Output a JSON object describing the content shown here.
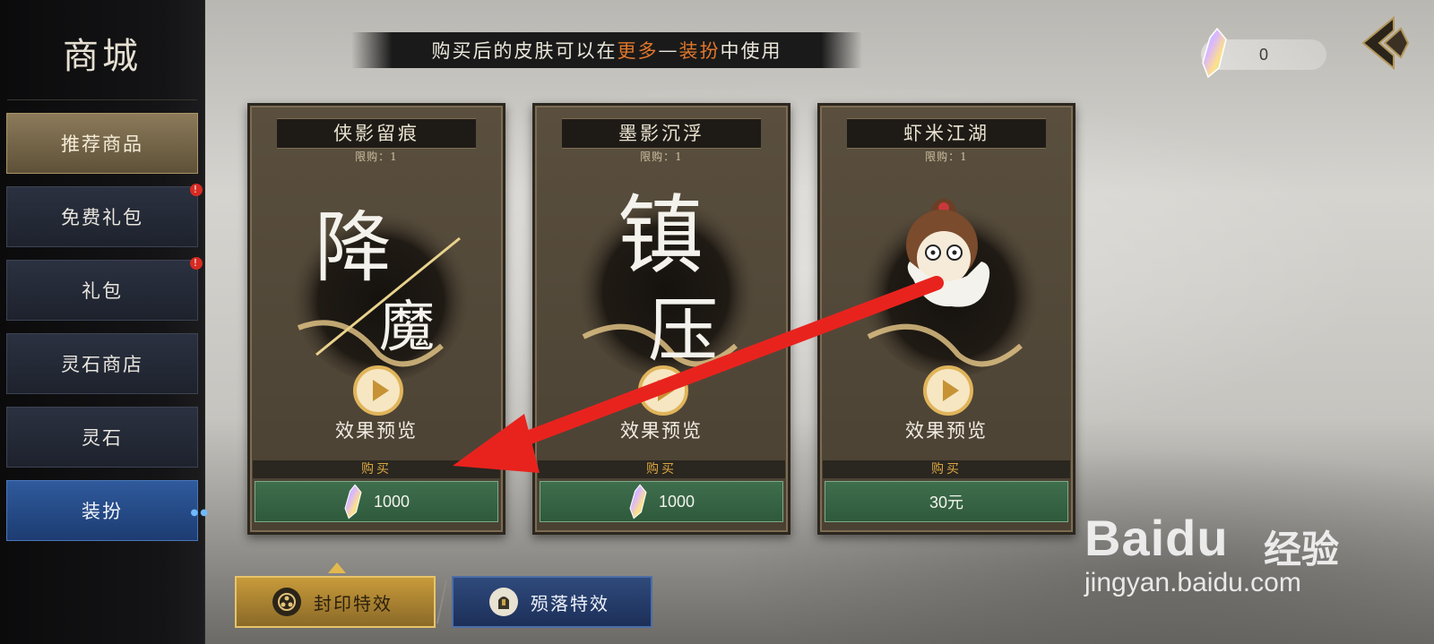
{
  "sidebar": {
    "title": "商城",
    "items": [
      {
        "label": "推荐商品"
      },
      {
        "label": "免费礼包",
        "badge": "!"
      },
      {
        "label": "礼包",
        "badge": "!"
      },
      {
        "label": "灵石商店"
      },
      {
        "label": "灵石"
      },
      {
        "label": "装扮"
      }
    ]
  },
  "banner": {
    "prefix": "购买后的皮肤可以在",
    "hl1": "更多",
    "dash": "—",
    "hl2": "装扮",
    "suffix": "中使用"
  },
  "currency": {
    "value": "0",
    "icon": "spirit-crystal-icon"
  },
  "cards": [
    {
      "title": "侠影留痕",
      "limit": "限购：1",
      "art_text": [
        "降",
        "魔"
      ],
      "preview": "效果预览",
      "buy": "购买",
      "price": "1000",
      "price_icon": "spirit-crystal-icon"
    },
    {
      "title": "墨影沉浮",
      "limit": "限购：1",
      "art_text": [
        "镇",
        "压"
      ],
      "preview": "效果预览",
      "buy": "购买",
      "price": "1000",
      "price_icon": "spirit-crystal-icon"
    },
    {
      "title": "虾米江湖",
      "limit": "限购：1",
      "preview": "效果预览",
      "buy": "购买",
      "price": "30元"
    }
  ],
  "bottom_tabs": [
    {
      "label": "封印特效",
      "icon": "seal-icon"
    },
    {
      "label": "殒落特效",
      "icon": "tombstone-icon"
    }
  ],
  "watermark": {
    "brand": "Baidu",
    "brand_cn": "经验",
    "url": "jingyan.baidu.com"
  },
  "colors": {
    "highlight": "#e0772b",
    "price_green": "#2e5a3b",
    "gold_tab": "#c89a3a",
    "blue_tab": "#1d3c72"
  }
}
